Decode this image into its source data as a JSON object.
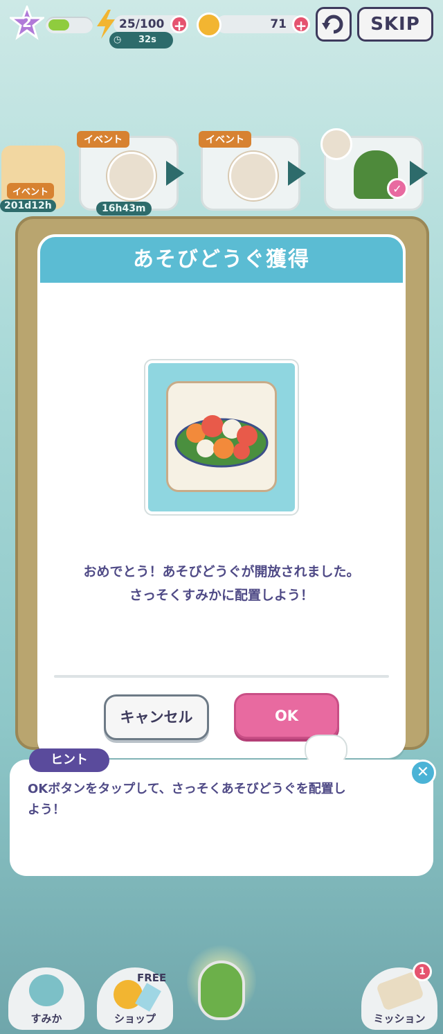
{
  "hud": {
    "level": "2",
    "xp_progress": 0.5,
    "energy": "25/100",
    "energy_timer": "32s",
    "coins": "71",
    "skip": "SKIP"
  },
  "events": [
    {
      "tag": "イベント",
      "time": "201d12h"
    },
    {
      "tag": "イベント",
      "time": "16h43m"
    },
    {
      "tag": "イベント"
    }
  ],
  "modal": {
    "title": "あそびどうぐ獲得",
    "message_line1": "おめでとう！あそびどうぐが開放されました。",
    "message_line2": "さっそくすみかに配置しよう！",
    "item_icon": "hibiscus-bush-icon",
    "cancel_label": "キャンセル",
    "ok_label": "OK"
  },
  "hint": {
    "tag": "ヒント",
    "text_line1": "OKボタンをタップして、さっそくあそびどうぐを配置し",
    "text_line2": "よう！"
  },
  "bottom_nav": {
    "home": "すみか",
    "shop": "ショップ",
    "shop_badge": "FREE",
    "mission": "ミッション",
    "mission_count": "1"
  },
  "colors": {
    "header": "#5bbcd3",
    "ok_button": "#e86aa0",
    "text": "#4f4a86"
  }
}
